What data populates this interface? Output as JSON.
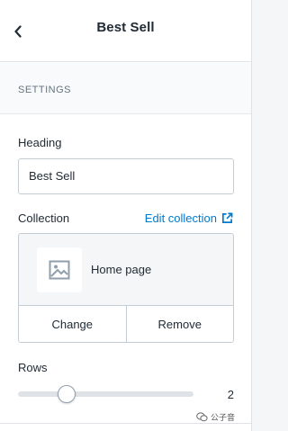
{
  "header": {
    "title": "Best Sell",
    "back_icon": "chevron-left-icon"
  },
  "section": {
    "label": "SETTINGS"
  },
  "heading_field": {
    "label": "Heading",
    "value": "Best Sell"
  },
  "collection": {
    "label": "Collection",
    "edit_link": "Edit collection",
    "edit_icon": "external-link-icon",
    "selected_name": "Home page",
    "thumb_icon": "image-placeholder-icon",
    "change_label": "Change",
    "remove_label": "Remove"
  },
  "rows": {
    "label": "Rows",
    "value": "2",
    "min": 1,
    "max": 5
  },
  "watermark": {
    "text": "公子音",
    "icon": "wechat-icon"
  },
  "colors": {
    "link": "#007ace",
    "border": "#c4cdd5",
    "text": "#212b36",
    "muted": "#637381"
  }
}
